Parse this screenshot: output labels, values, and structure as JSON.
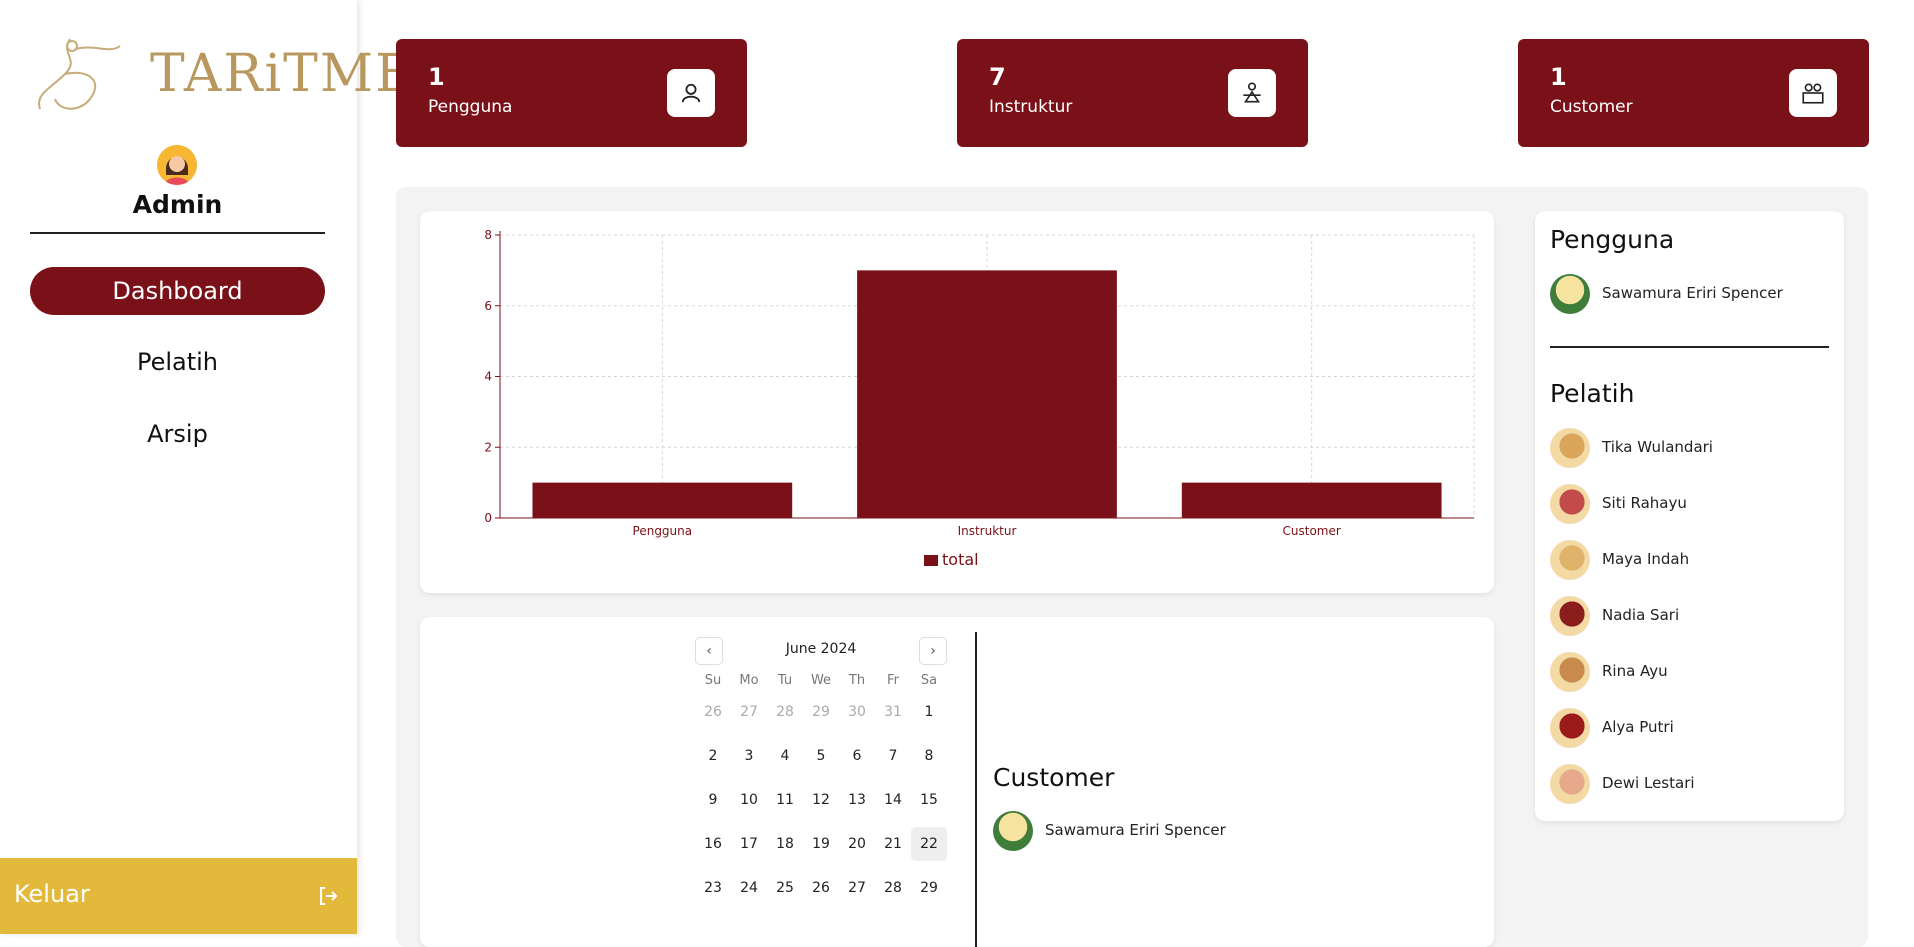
{
  "brand": {
    "logo_text": "TARiTME"
  },
  "sidebar": {
    "admin_name": "Admin",
    "nav": [
      {
        "label": "Dashboard",
        "active": true
      },
      {
        "label": "Pelatih",
        "active": false
      },
      {
        "label": "Arsip",
        "active": false
      }
    ],
    "logout_label": "Keluar"
  },
  "stats": [
    {
      "value": "1",
      "label": "Pengguna",
      "icon": "user-icon"
    },
    {
      "value": "7",
      "label": "Instruktur",
      "icon": "instructor-icon"
    },
    {
      "value": "1",
      "label": "Customer",
      "icon": "customer-icon"
    }
  ],
  "chart_data": {
    "type": "bar",
    "categories": [
      "Pengguna",
      "Instruktur",
      "Customer"
    ],
    "series": [
      {
        "name": "total",
        "values": [
          1,
          7,
          1
        ]
      }
    ],
    "ylim": [
      0,
      8
    ],
    "yticks": [
      0,
      2,
      4,
      6,
      8
    ],
    "grid": true,
    "legend": "bottom",
    "color": "#7a1118"
  },
  "calendar": {
    "month_label": "June 2024",
    "dow": [
      "Su",
      "Mo",
      "Tu",
      "We",
      "Th",
      "Fr",
      "Sa"
    ],
    "weeks": [
      [
        {
          "d": "26",
          "o": true
        },
        {
          "d": "27",
          "o": true
        },
        {
          "d": "28",
          "o": true
        },
        {
          "d": "29",
          "o": true
        },
        {
          "d": "30",
          "o": true
        },
        {
          "d": "31",
          "o": true
        },
        {
          "d": "1"
        }
      ],
      [
        {
          "d": "2"
        },
        {
          "d": "3"
        },
        {
          "d": "4"
        },
        {
          "d": "5"
        },
        {
          "d": "6"
        },
        {
          "d": "7"
        },
        {
          "d": "8"
        }
      ],
      [
        {
          "d": "9"
        },
        {
          "d": "10"
        },
        {
          "d": "11"
        },
        {
          "d": "12"
        },
        {
          "d": "13"
        },
        {
          "d": "14"
        },
        {
          "d": "15"
        }
      ],
      [
        {
          "d": "16"
        },
        {
          "d": "17"
        },
        {
          "d": "18"
        },
        {
          "d": "19"
        },
        {
          "d": "20"
        },
        {
          "d": "21"
        },
        {
          "d": "22",
          "t": true
        }
      ],
      [
        {
          "d": "23"
        },
        {
          "d": "24"
        },
        {
          "d": "25"
        },
        {
          "d": "26"
        },
        {
          "d": "27"
        },
        {
          "d": "28"
        },
        {
          "d": "29"
        }
      ]
    ]
  },
  "customer_panel": {
    "title": "Customer",
    "items": [
      {
        "name": "Sawamura Eriri Spencer"
      }
    ]
  },
  "right_panel": {
    "pengguna_title": "Pengguna",
    "pengguna": [
      {
        "name": "Sawamura Eriri Spencer"
      }
    ],
    "pelatih_title": "Pelatih",
    "pelatih": [
      {
        "name": "Tika Wulandari"
      },
      {
        "name": "Siti Rahayu"
      },
      {
        "name": "Maya Indah"
      },
      {
        "name": "Nadia Sari"
      },
      {
        "name": "Rina Ayu"
      },
      {
        "name": "Alya Putri"
      },
      {
        "name": "Dewi Lestari"
      }
    ]
  },
  "colors": {
    "accent": "#7a1118",
    "logout_bg": "#e3b93c",
    "panel_bg": "#f3f3f3"
  }
}
